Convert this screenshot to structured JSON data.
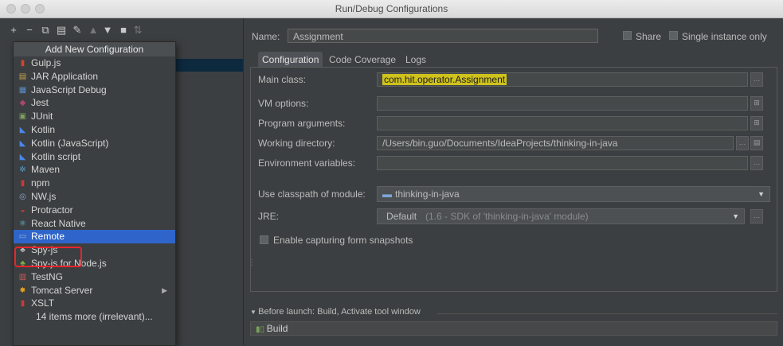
{
  "window": {
    "title": "Run/Debug Configurations"
  },
  "popup": {
    "title": "Add New Configuration",
    "items": [
      {
        "label": "Gulp.js",
        "icon": "gulp-icon",
        "color": "#d0452e",
        "glyph": "▮"
      },
      {
        "label": "JAR Application",
        "icon": "jar-icon",
        "color": "#c8a24a",
        "glyph": "▤"
      },
      {
        "label": "JavaScript Debug",
        "icon": "javascript-debug-icon",
        "color": "#5a8ec7",
        "glyph": "▦"
      },
      {
        "label": "Jest",
        "icon": "jest-icon",
        "color": "#a8486d",
        "glyph": "◆"
      },
      {
        "label": "JUnit",
        "icon": "junit-icon",
        "color": "#7aa05a",
        "glyph": "▣"
      },
      {
        "label": "Kotlin",
        "icon": "kotlin-icon",
        "color": "#4a86e8",
        "glyph": "◣"
      },
      {
        "label": "Kotlin (JavaScript)",
        "icon": "kotlin-js-icon",
        "color": "#4a86e8",
        "glyph": "◣"
      },
      {
        "label": "Kotlin script",
        "icon": "kotlin-script-icon",
        "color": "#4a86e8",
        "glyph": "◣"
      },
      {
        "label": "Maven",
        "icon": "maven-icon",
        "color": "#5aa0c8",
        "glyph": "✲"
      },
      {
        "label": "npm",
        "icon": "npm-icon",
        "color": "#cb3837",
        "glyph": "▮"
      },
      {
        "label": "NW.js",
        "icon": "nwjs-icon",
        "color": "#8aa8c8",
        "glyph": "◎"
      },
      {
        "label": "Protractor",
        "icon": "protractor-icon",
        "color": "#d03a3a",
        "glyph": "◒"
      },
      {
        "label": "React Native",
        "icon": "react-native-icon",
        "color": "#61c8e8",
        "glyph": "⚛"
      },
      {
        "label": "Remote",
        "icon": "remote-icon",
        "color": "#9fb8d8",
        "glyph": "▭"
      },
      {
        "label": "Spy-js",
        "icon": "spy-js-icon",
        "color": "#b8b8b8",
        "glyph": "♣"
      },
      {
        "label": "Spy-js for Node.js",
        "icon": "spy-js-node-icon",
        "color": "#7ab04a",
        "glyph": "♣"
      },
      {
        "label": "TestNG",
        "icon": "testng-icon",
        "color": "#c85a5a",
        "glyph": "▥"
      },
      {
        "label": "Tomcat Server",
        "icon": "tomcat-icon",
        "color": "#e0a020",
        "glyph": "✸"
      },
      {
        "label": "XSLT",
        "icon": "xslt-icon",
        "color": "#c83a3a",
        "glyph": "▮"
      },
      {
        "label": "14 items more (irrelevant)...",
        "icon": "",
        "color": "",
        "glyph": ""
      }
    ],
    "selected_index": 13,
    "submenu_index": 17
  },
  "form": {
    "name_label": "Name:",
    "name_value": "Assignment",
    "share_label": "Share",
    "single_instance_label": "Single instance only",
    "tabs": [
      "Configuration",
      "Code Coverage",
      "Logs"
    ],
    "active_tab": 0,
    "main_class_label": "Main class:",
    "main_class_value": "com.hit.operator.Assignment",
    "vm_options_label": "VM options:",
    "vm_options_value": "",
    "program_args_label": "Program arguments:",
    "program_args_value": "",
    "working_dir_label": "Working directory:",
    "working_dir_value": "/Users/bin.guo/Documents/IdeaProjects/thinking-in-java",
    "env_vars_label": "Environment variables:",
    "env_vars_value": "",
    "classpath_label": "Use classpath of module:",
    "classpath_value": "thinking-in-java",
    "jre_label": "JRE:",
    "jre_default": "Default",
    "jre_detail": "(1.6 - SDK of 'thinking-in-java' module)",
    "enable_snapshots_label": "Enable capturing form snapshots",
    "before_launch_label": "Before launch: Build, Activate tool window",
    "build_item": "Build"
  },
  "colors": {
    "selection": "#2f65ca",
    "highlight_box": "#e8242b",
    "main_class_highlight": "#cfc21c"
  }
}
